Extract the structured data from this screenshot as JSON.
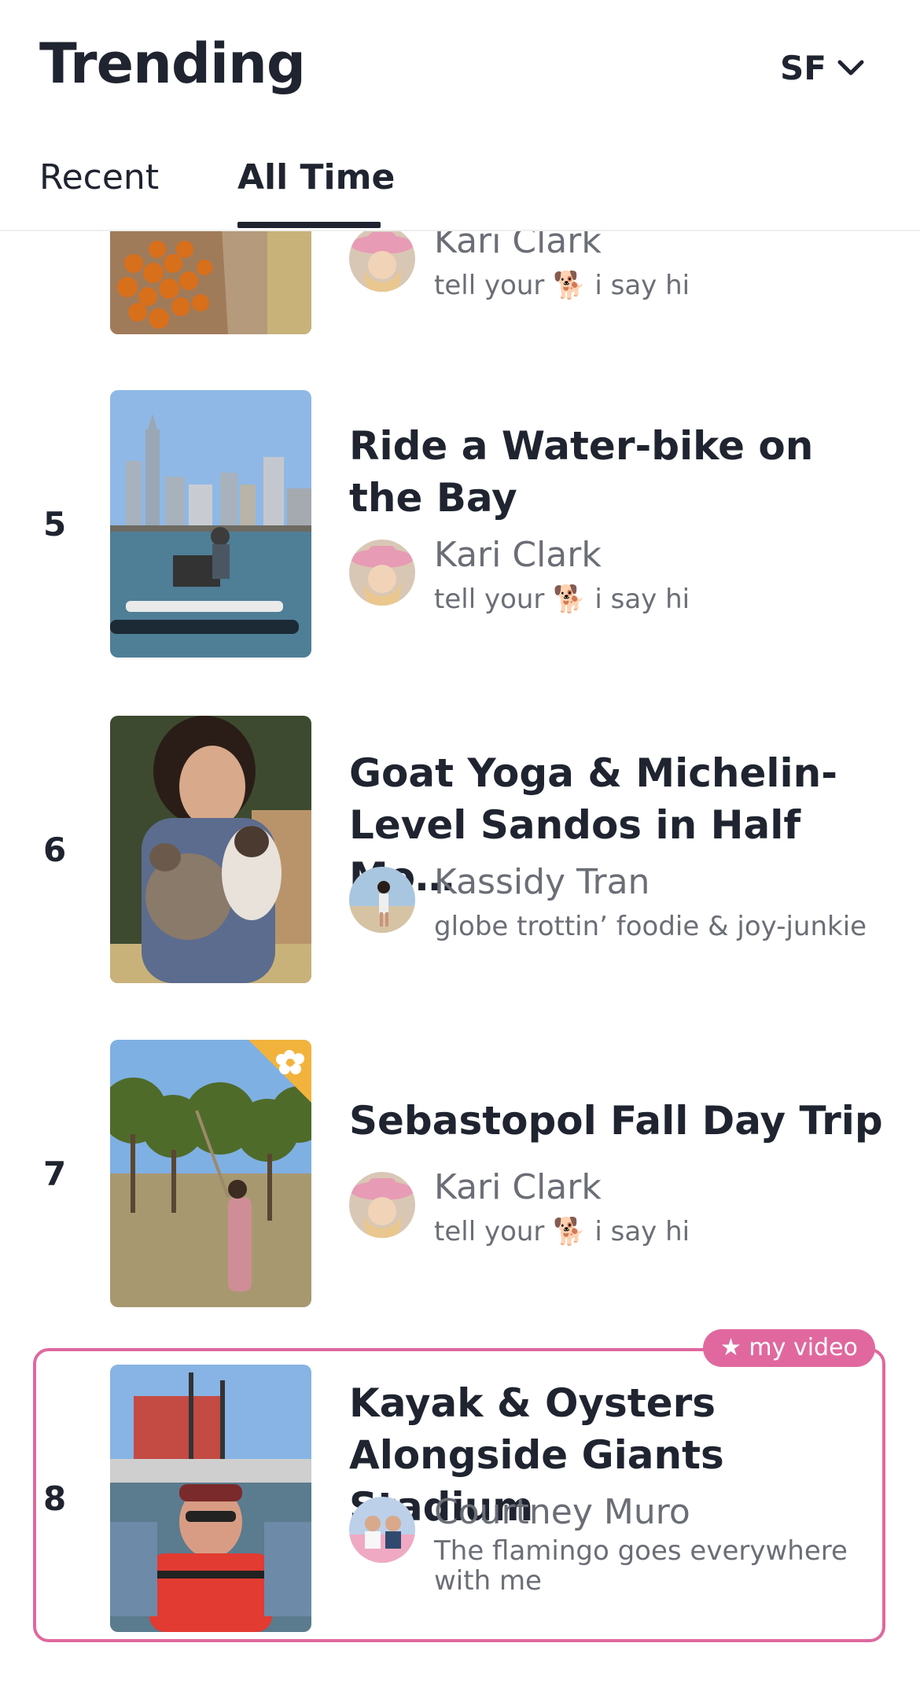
{
  "header": {
    "title": "Trending",
    "city": "SF",
    "tabs": [
      "Recent",
      "All Time"
    ]
  },
  "items": [
    {
      "rank": "",
      "title": "",
      "author": "Kari Clark",
      "bio_pre": "tell your",
      "bio_post": "i say hi"
    },
    {
      "rank": "5",
      "title": "Ride a Water-bike on the Bay",
      "author": "Kari Clark",
      "bio_pre": "tell your",
      "bio_post": "i say hi"
    },
    {
      "rank": "6",
      "title": "Goat Yoga & Michelin-Level Sandos in Half Mo…",
      "author": "Kassidy Tran",
      "bio": "globe trottin’ foodie & joy-junkie"
    },
    {
      "rank": "7",
      "title": "Sebastopol Fall Day Trip",
      "author": "Kari Clark",
      "bio_pre": "tell your",
      "bio_post": "i say hi"
    },
    {
      "rank": "8",
      "title": "Kayak & Oysters Alongside Giants Stadium",
      "author": "Courtney Muro",
      "bio": "The flamingo goes everywhere with me",
      "badge": "★ my video"
    }
  ],
  "icons": {
    "chevron": "chevron-down-icon",
    "dog": "dog-emoji-icon",
    "flower": "flower-badge-icon",
    "star": "star-icon"
  },
  "colors": {
    "accent": "#e0689e",
    "text": "#1f2430",
    "muted": "#6b6e76",
    "flower_badge": "#f2b33d"
  }
}
